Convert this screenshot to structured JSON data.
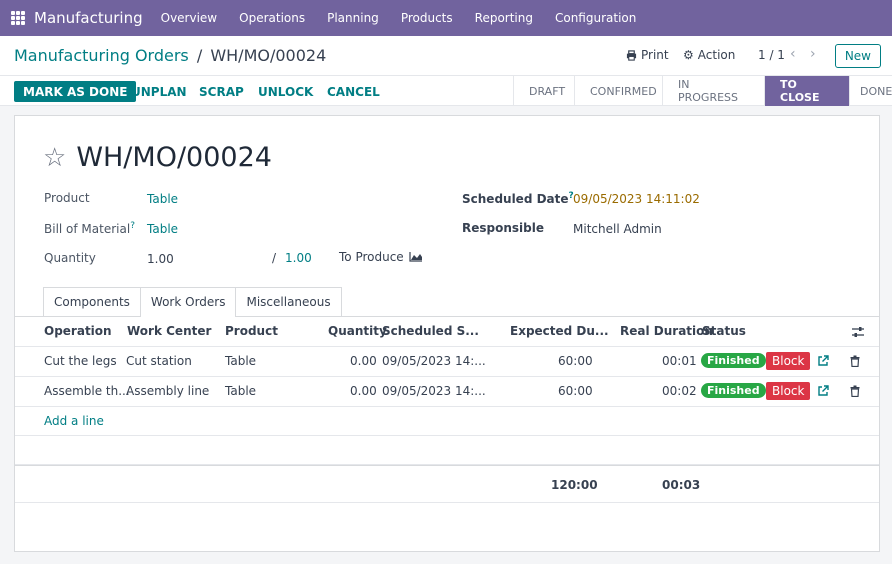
{
  "app": {
    "brand": "Manufacturing",
    "menu": [
      "Overview",
      "Operations",
      "Planning",
      "Products",
      "Reporting",
      "Configuration"
    ]
  },
  "breadcrumb": {
    "parent": "Manufacturing Orders",
    "separator": "/",
    "current": "WH/MO/00024"
  },
  "control": {
    "print_label": "Print",
    "action_label": "Action",
    "pager": "1 / 1",
    "new_label": "New"
  },
  "actions": {
    "mark_done": "MARK AS DONE",
    "unplan": "UNPLAN",
    "scrap": "SCRAP",
    "unlock": "UNLOCK",
    "cancel": "CANCEL"
  },
  "stages": [
    "DRAFT",
    "CONFIRMED",
    "IN PROGRESS",
    "TO CLOSE",
    "DONE"
  ],
  "active_stage": "TO CLOSE",
  "form": {
    "title": "WH/MO/00024",
    "product_label": "Product",
    "product_value": "Table",
    "bom_label": "Bill of Material",
    "bom_value": "Table",
    "quantity_label": "Quantity",
    "quantity_value": "1.00",
    "quantity_sep": "/",
    "quantity_total": "1.00",
    "to_produce_label": "To Produce",
    "scheduled_label": "Scheduled Date",
    "scheduled_value": "09/05/2023 14:11:02",
    "responsible_label": "Responsible",
    "responsible_value": "Mitchell Admin",
    "help_mark": "?"
  },
  "tabs": [
    "Components",
    "Work Orders",
    "Miscellaneous"
  ],
  "active_tab": "Work Orders",
  "table": {
    "headers": {
      "operation": "Operation",
      "work_center": "Work Center",
      "product": "Product",
      "quantity": "Quantity",
      "scheduled": "Scheduled S...",
      "expected": "Expected Du...",
      "real": "Real Duration",
      "status": "Status"
    },
    "rows": [
      {
        "operation": "Cut the legs",
        "work_center": "Cut station",
        "product": "Table",
        "quantity": "0.00",
        "scheduled": "09/05/2023 14:...",
        "expected": "60:00",
        "real": "00:01",
        "status": "Finished",
        "block": "Block"
      },
      {
        "operation": "Assemble th...",
        "work_center": "Assembly line",
        "product": "Table",
        "quantity": "0.00",
        "scheduled": "09/05/2023 14:...",
        "expected": "60:00",
        "real": "00:02",
        "status": "Finished",
        "block": "Block"
      }
    ],
    "add_line": "Add a line",
    "totals": {
      "expected": "120:00",
      "real": "00:03"
    }
  },
  "colors": {
    "brand_purple": "#71639e",
    "accent_teal": "#017e84",
    "finished_green": "#28a745",
    "block_red": "#dc3545"
  }
}
